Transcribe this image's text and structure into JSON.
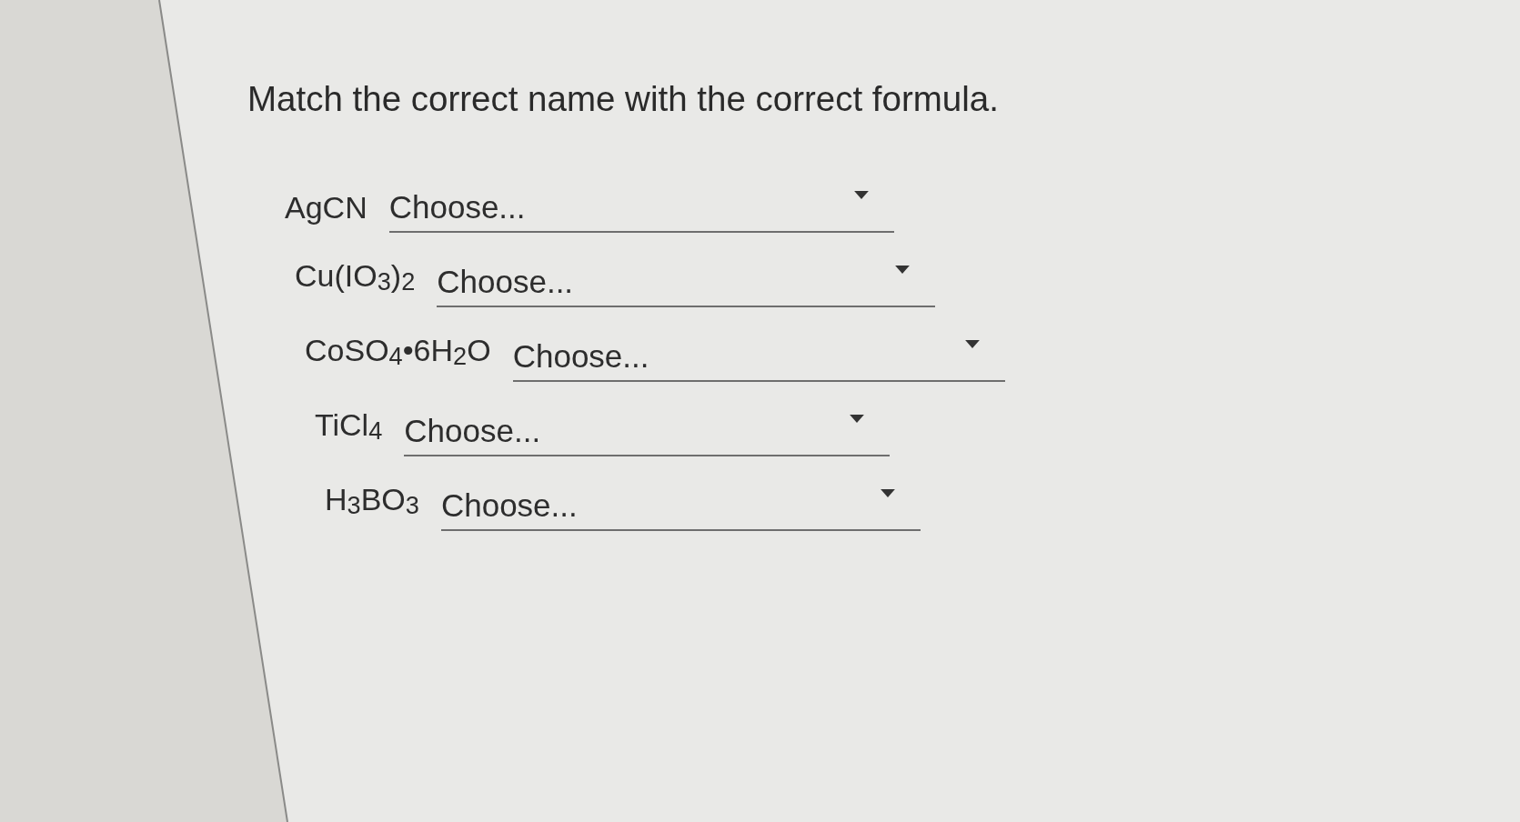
{
  "question": {
    "text": "Match the correct name with the correct formula."
  },
  "rows": [
    {
      "formula": "AgCN",
      "dropdown": {
        "placeholder": "Choose..."
      }
    },
    {
      "formula": "Cu(IO$_{3}$)$_{2}$",
      "dropdown": {
        "placeholder": "Choose..."
      }
    },
    {
      "formula": "CoSO$_{4}$•6H$_{2}$O",
      "dropdown": {
        "placeholder": "Choose..."
      }
    },
    {
      "formula": "TiCl$_{4}$",
      "dropdown": {
        "placeholder": "Choose..."
      }
    },
    {
      "formula": "H$_{3}$BO$_{3}$",
      "dropdown": {
        "placeholder": "Choose..."
      }
    }
  ]
}
